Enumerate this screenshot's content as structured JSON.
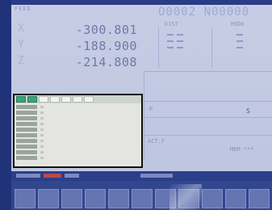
{
  "header": {
    "top_label": "FEED",
    "program_number": "O0002 N00000"
  },
  "position": {
    "axes": [
      {
        "letter": "X",
        "value": "-300.801"
      },
      {
        "letter": "Y",
        "value": "-188.900"
      },
      {
        "letter": "Z",
        "value": "-214.808"
      }
    ]
  },
  "columns": {
    "head_1": "DIST",
    "head_2": "MODE"
  },
  "panel": {
    "label_1": "R",
    "label_2": "S",
    "label_3": "ACT.F",
    "label_4": "MEM ***"
  },
  "popup": {
    "title": "TABLE"
  },
  "softkeys": {
    "keys": [
      "",
      "",
      "",
      "",
      "",
      "",
      "",
      "",
      "",
      "",
      ""
    ]
  },
  "colors": {
    "screen_bg": "#c7cde4",
    "bezel": "#203379",
    "popup_accent": "#3aa37e",
    "status_red": "#b84a4a"
  }
}
